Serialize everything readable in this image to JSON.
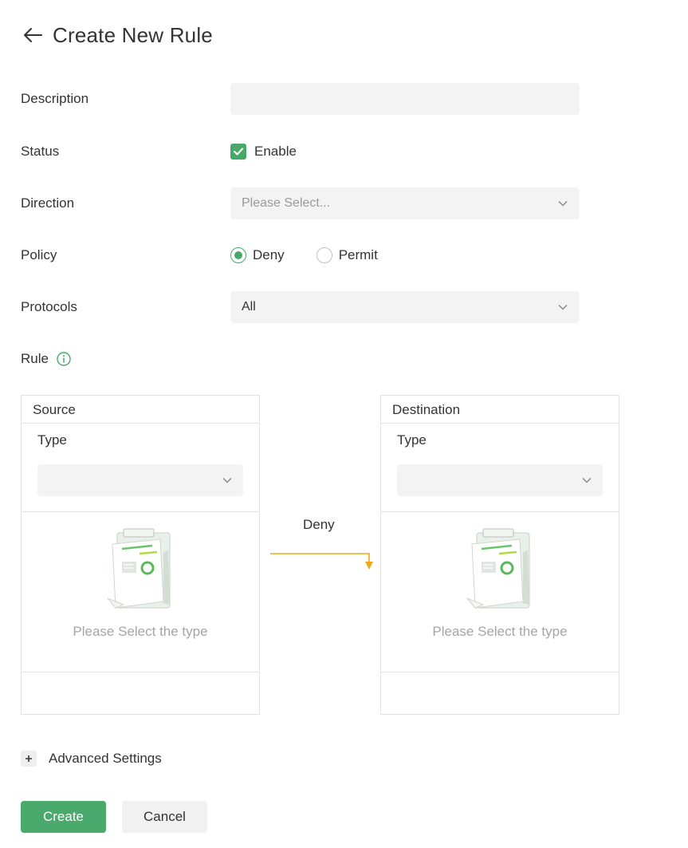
{
  "header": {
    "title": "Create New Rule"
  },
  "form": {
    "description": {
      "label": "Description",
      "value": "",
      "placeholder": ""
    },
    "status": {
      "label": "Status",
      "checkbox_label": "Enable",
      "checked": true
    },
    "direction": {
      "label": "Direction",
      "placeholder": "Please Select..."
    },
    "policy": {
      "label": "Policy",
      "options": [
        {
          "label": "Deny",
          "selected": true
        },
        {
          "label": "Permit",
          "selected": false
        }
      ]
    },
    "protocols": {
      "label": "Protocols",
      "value": "All"
    },
    "rule": {
      "label": "Rule"
    }
  },
  "source": {
    "title": "Source",
    "type_label": "Type",
    "type_value": "",
    "empty_text": "Please Select the type"
  },
  "destination": {
    "title": "Destination",
    "type_label": "Type",
    "type_value": "",
    "empty_text": "Please Select the type"
  },
  "flow": {
    "label": "Deny"
  },
  "advanced": {
    "label": "Advanced Settings"
  },
  "actions": {
    "create_label": "Create",
    "cancel_label": "Cancel"
  },
  "colors": {
    "primary": "#4aa96c",
    "arrow": "#f0a818",
    "field_bg": "#f3f3f3",
    "border": "#e2e2e2",
    "placeholder_text": "#9a9a9a"
  },
  "icons": {
    "back": "arrow-left-icon",
    "checkbox": "check-icon",
    "chevron": "chevron-down-icon",
    "info": "info-circle-icon",
    "empty": "clipboard-illustration",
    "expand": "plus-icon"
  }
}
